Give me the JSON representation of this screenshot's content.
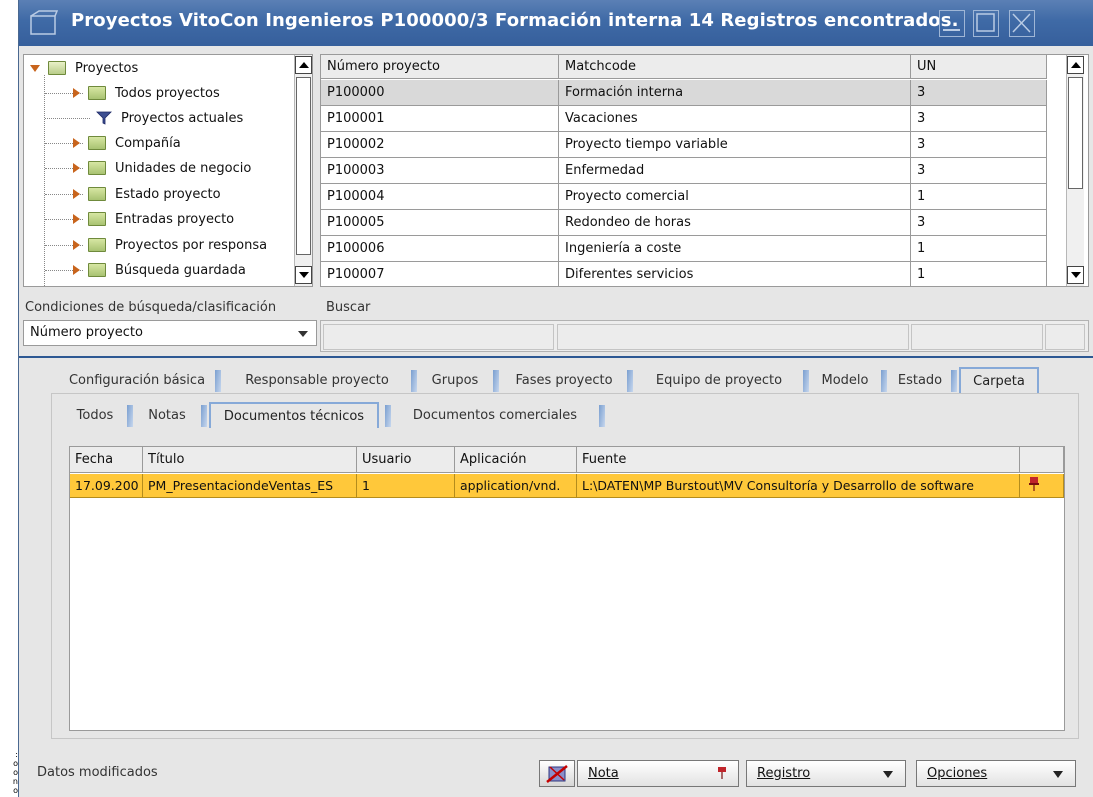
{
  "window": {
    "title": "Proyectos VitoCon Ingenieros P100000/3 Formación interna   14 Registros encontrados."
  },
  "tree": {
    "items": [
      {
        "label": "Proyectos",
        "icon": "folder-open-icon",
        "expanded": true
      },
      {
        "label": "Todos proyectos",
        "icon": "folder-icon"
      },
      {
        "label": "Proyectos actuales",
        "icon": "filter-icon"
      },
      {
        "label": "Compañía",
        "icon": "folder-icon"
      },
      {
        "label": "Unidades de negocio",
        "icon": "folder-icon"
      },
      {
        "label": "Estado proyecto",
        "icon": "folder-icon"
      },
      {
        "label": "Entradas proyecto",
        "icon": "folder-icon"
      },
      {
        "label": "Proyectos por responsa",
        "icon": "folder-icon"
      },
      {
        "label": "Búsqueda guardada",
        "icon": "folder-icon"
      }
    ]
  },
  "project_grid": {
    "columns": [
      "Número proyecto",
      "Matchcode",
      "UN"
    ],
    "rows": [
      [
        "P100000",
        "Formación interna",
        "3"
      ],
      [
        "P100001",
        "Vacaciones",
        "3"
      ],
      [
        "P100002",
        "Proyecto tiempo variable",
        "3"
      ],
      [
        "P100003",
        "Enfermedad",
        "3"
      ],
      [
        "P100004",
        "Proyecto comercial",
        "1"
      ],
      [
        "P100005",
        "Redondeo de horas",
        "3"
      ],
      [
        "P100006",
        "Ingeniería a coste",
        "1"
      ],
      [
        "P100007",
        "Diferentes servicios",
        "1"
      ]
    ],
    "selected_row": 0
  },
  "search": {
    "conditions_label": "Condiciones de búsqueda/clasificación",
    "buscar_label": "Buscar",
    "sort_field": "Número proyecto"
  },
  "tabs_main": [
    {
      "label": "Configuración básica"
    },
    {
      "label": "Responsable proyecto"
    },
    {
      "label": "Grupos"
    },
    {
      "label": "Fases proyecto"
    },
    {
      "label": "Equipo de proyecto"
    },
    {
      "label": "Modelo"
    },
    {
      "label": "Estado"
    },
    {
      "label": "Carpeta",
      "active": true
    }
  ],
  "tabs_sub": [
    {
      "label": "Todos"
    },
    {
      "label": "Notas"
    },
    {
      "label": "Documentos técnicos",
      "active": true
    },
    {
      "label": "Documentos comerciales"
    }
  ],
  "docs_grid": {
    "columns": [
      "Fecha",
      "Título",
      "Usuario",
      "Aplicación",
      "Fuente"
    ],
    "rows": [
      [
        "17.09.200",
        "PM_PresentaciondeVentas_ES",
        "1",
        "application/vnd.",
        "L:\\DATEN\\MP Burstout\\MV Consultoría y Desarrollo de software"
      ]
    ]
  },
  "footer": {
    "status": "Datos modificados",
    "nota_label": "Nota",
    "registro_label": "Registro",
    "opciones_label": "Opciones"
  },
  "colors": {
    "title_bar": "#3f6aa6",
    "selected_doc_row": "#ffc83a",
    "separator": "#2d5893"
  }
}
